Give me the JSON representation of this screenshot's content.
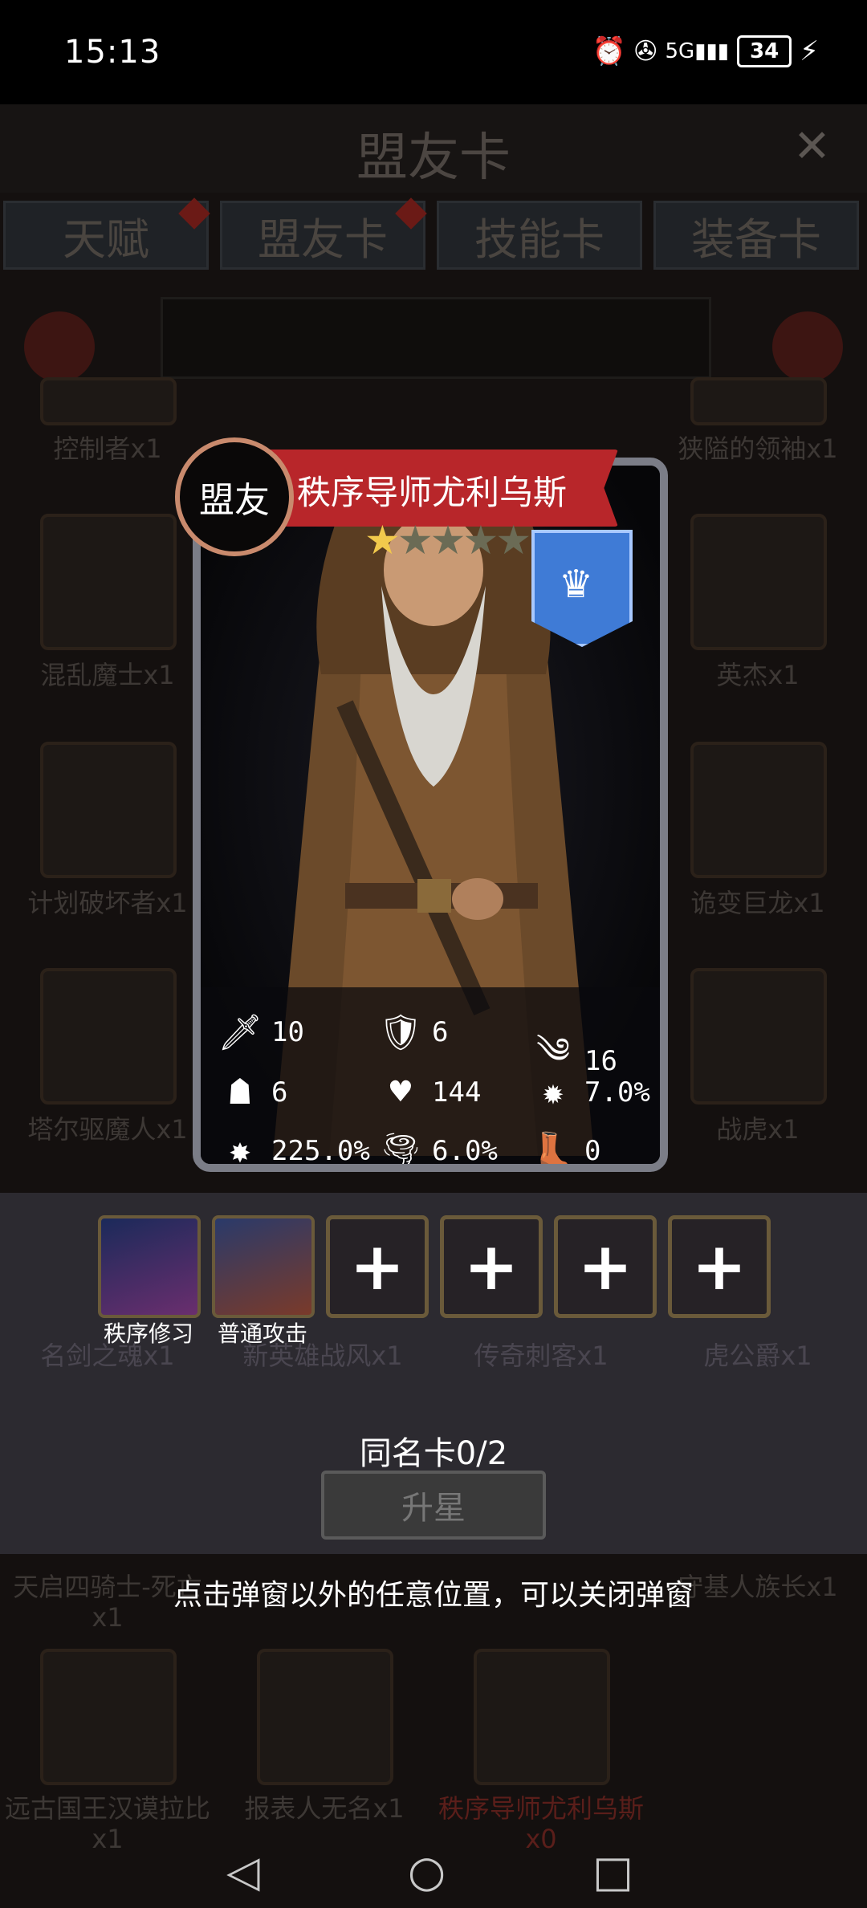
{
  "status_bar": {
    "time": "15:13",
    "battery": "34",
    "network": "5G"
  },
  "header": {
    "title": "盟友卡",
    "close_icon": "close-icon"
  },
  "tabs": [
    {
      "label": "天赋",
      "has_dot": true
    },
    {
      "label": "盟友卡",
      "has_dot": true
    },
    {
      "label": "技能卡",
      "has_dot": false
    },
    {
      "label": "装备卡",
      "has_dot": false
    }
  ],
  "background_cards": [
    "控制者x1",
    "狭隘的领袖x1",
    "混乱魔士x1",
    "英杰x1",
    "计划破坏者x1",
    "诡变巨龙x1",
    "塔尔驱魔人x1",
    "战虎x1",
    "名剑之魂x1",
    "新英雄战风x1",
    "传奇刺客x1",
    "虎公爵x1",
    "天启四骑士-死亡x1",
    "守基人族长x1",
    "远古国王汉谟拉比x1",
    "报表人无名x1",
    "秩序导师尤利乌斯x0"
  ],
  "card": {
    "type_badge": "盟友",
    "name": "秩序导师尤利乌斯",
    "stars_filled": 1,
    "stars_total": 5,
    "stats": [
      {
        "icon": "sword-icon",
        "value": "10"
      },
      {
        "icon": "shield-icon",
        "value": "6"
      },
      {
        "icon": "speed-icon",
        "value": "16"
      },
      {
        "icon": "hood-icon",
        "value": "6"
      },
      {
        "icon": "heart-icon",
        "value": "144"
      },
      {
        "icon": "crit-icon",
        "value": "7.0%"
      },
      {
        "icon": "crit-damage-icon",
        "value": "225.0%"
      },
      {
        "icon": "tornado-icon",
        "value": "6.0%"
      },
      {
        "icon": "boot-icon",
        "value": "0"
      }
    ]
  },
  "skills": [
    {
      "label": "秩序修习",
      "color": "#3a3f8a"
    },
    {
      "label": "普通攻击",
      "color": "#5a3a3a"
    }
  ],
  "empty_slots": 4,
  "same_card": "同名卡0/2",
  "upgrade_button": "升星",
  "hint": "点击弹窗以外的任意位置，可以关闭弹窗"
}
